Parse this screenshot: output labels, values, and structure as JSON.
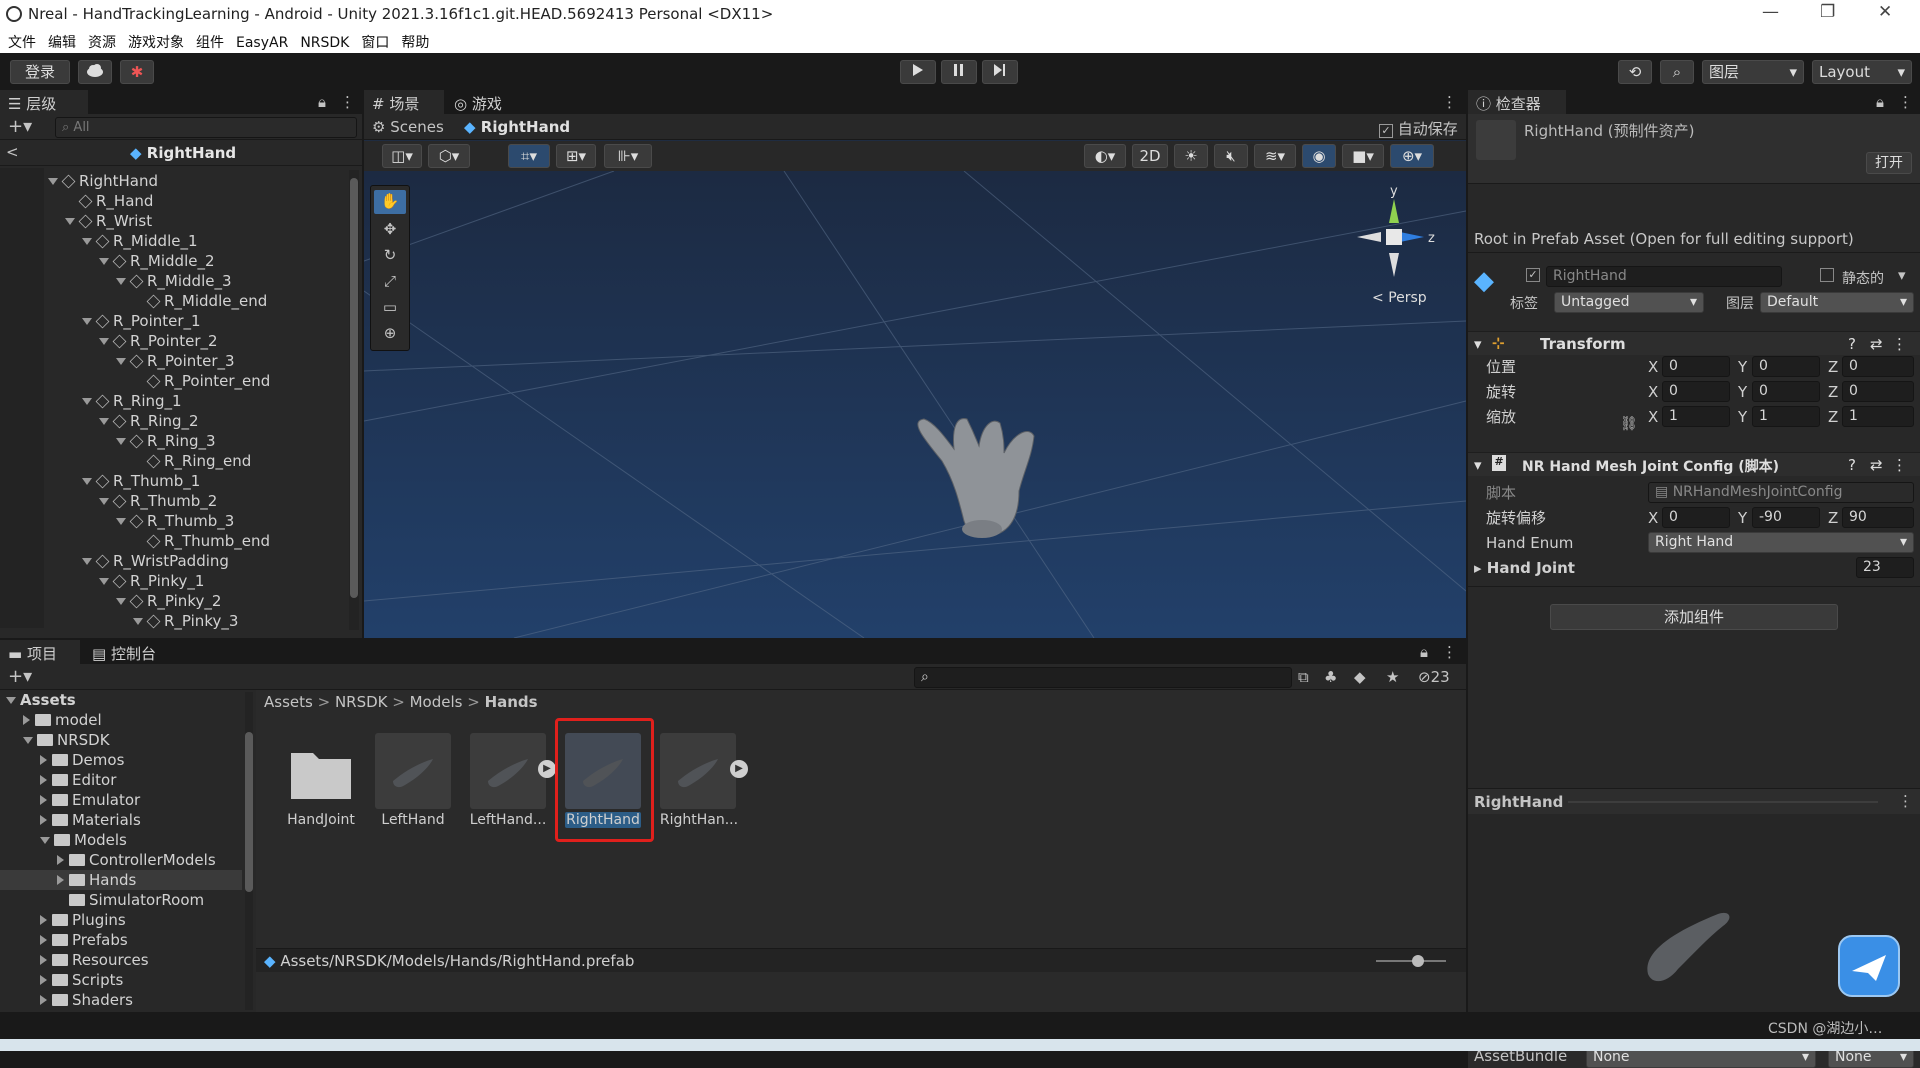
{
  "window": {
    "title": "Nreal - HandTrackingLearning - Android - Unity 2021.3.16f1c1.git.HEAD.5692413 Personal <DX11>",
    "minimize": "—",
    "restore": "❐",
    "close": "✕"
  },
  "menu": [
    "文件",
    "编辑",
    "资源",
    "游戏对象",
    "组件",
    "EasyAR",
    "NRSDK",
    "窗口",
    "帮助"
  ],
  "toolbar": {
    "login": "登录",
    "layers": "图层",
    "layout": "Layout"
  },
  "hierarchy": {
    "tab": "层级",
    "search_placeholder": "All",
    "root": "RightHand",
    "items": [
      {
        "label": "RightHand",
        "depth": 0,
        "arrow": "down"
      },
      {
        "label": "R_Hand",
        "depth": 1,
        "arrow": "none"
      },
      {
        "label": "R_Wrist",
        "depth": 1,
        "arrow": "down"
      },
      {
        "label": "R_Middle_1",
        "depth": 2,
        "arrow": "down"
      },
      {
        "label": "R_Middle_2",
        "depth": 3,
        "arrow": "down"
      },
      {
        "label": "R_Middle_3",
        "depth": 4,
        "arrow": "down"
      },
      {
        "label": "R_Middle_end",
        "depth": 5,
        "arrow": "none"
      },
      {
        "label": "R_Pointer_1",
        "depth": 2,
        "arrow": "down"
      },
      {
        "label": "R_Pointer_2",
        "depth": 3,
        "arrow": "down"
      },
      {
        "label": "R_Pointer_3",
        "depth": 4,
        "arrow": "down"
      },
      {
        "label": "R_Pointer_end",
        "depth": 5,
        "arrow": "none"
      },
      {
        "label": "R_Ring_1",
        "depth": 2,
        "arrow": "down"
      },
      {
        "label": "R_Ring_2",
        "depth": 3,
        "arrow": "down"
      },
      {
        "label": "R_Ring_3",
        "depth": 4,
        "arrow": "down"
      },
      {
        "label": "R_Ring_end",
        "depth": 5,
        "arrow": "none"
      },
      {
        "label": "R_Thumb_1",
        "depth": 2,
        "arrow": "down"
      },
      {
        "label": "R_Thumb_2",
        "depth": 3,
        "arrow": "down"
      },
      {
        "label": "R_Thumb_3",
        "depth": 4,
        "arrow": "down"
      },
      {
        "label": "R_Thumb_end",
        "depth": 5,
        "arrow": "none"
      },
      {
        "label": "R_WristPadding",
        "depth": 2,
        "arrow": "down"
      },
      {
        "label": "R_Pinky_1",
        "depth": 3,
        "arrow": "down"
      },
      {
        "label": "R_Pinky_2",
        "depth": 4,
        "arrow": "down"
      },
      {
        "label": "R_Pinky_3",
        "depth": 5,
        "arrow": "down"
      }
    ]
  },
  "scene": {
    "tab_scene": "场景",
    "tab_game": "游戏",
    "breadcrumb_root": "Scenes",
    "breadcrumb_item": "RightHand",
    "autosave": "自动保存",
    "btn_2d": "2D",
    "gizmo_y": "y",
    "gizmo_z": "z",
    "persp": "Persp"
  },
  "inspector": {
    "tab": "检查器",
    "asset_title": "RightHand (预制件资产)",
    "open": "打开",
    "root_notice": "Root in Prefab Asset (Open for full editing support)",
    "object_name": "RightHand",
    "static": "静态的",
    "tag_label": "标签",
    "tag_value": "Untagged",
    "layer_label": "图层",
    "layer_value": "Default",
    "transform": {
      "title": "Transform",
      "rows": [
        {
          "label": "位置",
          "x": "0",
          "y": "0",
          "z": "0"
        },
        {
          "label": "旋转",
          "x": "0",
          "y": "0",
          "z": "0"
        },
        {
          "label": "缩放",
          "x": "1",
          "y": "1",
          "z": "1"
        }
      ]
    },
    "script_comp": {
      "title": "NR Hand Mesh Joint Config (脚本)",
      "script_label": "脚本",
      "script_value": "NRHandMeshJointConfig",
      "offset_label": "旋转偏移",
      "offset_x": "0",
      "offset_y": "-90",
      "offset_z": "90",
      "enum_label": "Hand Enum",
      "enum_value": "Right Hand",
      "joint_label": "Hand Joint",
      "joint_value": "23"
    },
    "add_component": "添加组件",
    "preview_title": "RightHand",
    "assetbundle_label": "AssetBundle",
    "assetbundle_value": "None",
    "assetbundle_variant": "None"
  },
  "axis": {
    "x": "X",
    "y": "Y",
    "z": "Z"
  },
  "project": {
    "tab_project": "项目",
    "tab_console": "控制台",
    "hidden_count": "23",
    "tree": [
      {
        "label": "Assets",
        "depth": 0,
        "arrow": "down",
        "bold": true,
        "folder": false
      },
      {
        "label": "model",
        "depth": 1,
        "arrow": "right",
        "folder": true
      },
      {
        "label": "NRSDK",
        "depth": 1,
        "arrow": "down",
        "folder": true
      },
      {
        "label": "Demos",
        "depth": 2,
        "arrow": "right",
        "folder": true
      },
      {
        "label": "Editor",
        "depth": 2,
        "arrow": "right",
        "folder": true
      },
      {
        "label": "Emulator",
        "depth": 2,
        "arrow": "right",
        "folder": true
      },
      {
        "label": "Materials",
        "depth": 2,
        "arrow": "right",
        "folder": true
      },
      {
        "label": "Models",
        "depth": 2,
        "arrow": "down",
        "folder": true
      },
      {
        "label": "ControllerModels",
        "depth": 3,
        "arrow": "right",
        "folder": true
      },
      {
        "label": "Hands",
        "depth": 3,
        "arrow": "right",
        "folder": true,
        "selected": true
      },
      {
        "label": "SimulatorRoom",
        "depth": 3,
        "arrow": "none",
        "folder": true
      },
      {
        "label": "Plugins",
        "depth": 2,
        "arrow": "right",
        "folder": true
      },
      {
        "label": "Prefabs",
        "depth": 2,
        "arrow": "right",
        "folder": true
      },
      {
        "label": "Resources",
        "depth": 2,
        "arrow": "right",
        "folder": true
      },
      {
        "label": "Scripts",
        "depth": 2,
        "arrow": "right",
        "folder": true
      },
      {
        "label": "Shaders",
        "depth": 2,
        "arrow": "right",
        "folder": true
      }
    ],
    "breadcrumb": [
      "Assets",
      "NRSDK",
      "Models",
      "Hands"
    ],
    "assets": [
      {
        "label": "HandJoint"
      },
      {
        "label": "LeftHand"
      },
      {
        "label": "LeftHand..."
      },
      {
        "label": "RightHand"
      },
      {
        "label": "RightHan..."
      }
    ],
    "path": "Assets/NRSDK/Models/Hands/RightHand.prefab"
  },
  "watermark": "CSDN @湖边小…"
}
